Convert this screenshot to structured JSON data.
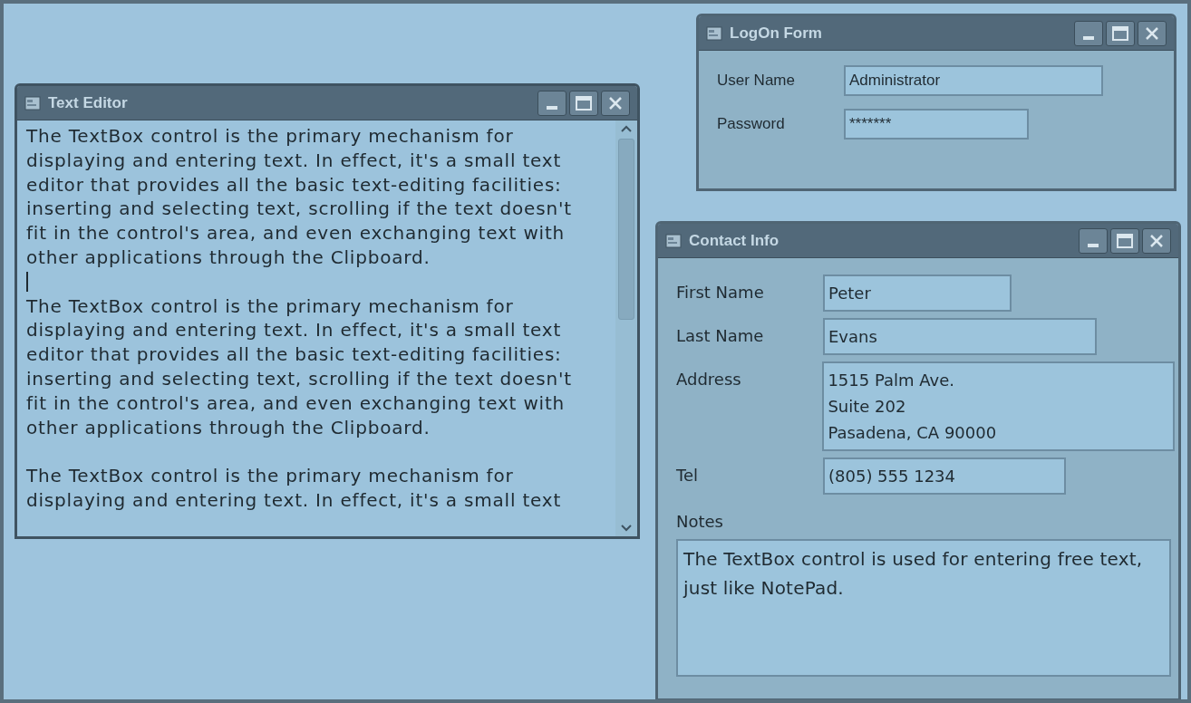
{
  "windows": [
    {
      "kind": "editor",
      "title": "Text Editor",
      "blocks": [
        {
          "kind": "text",
          "lines": [
            "The TextBox control is the primary mechanism for",
            "displaying and entering text. In effect, it's a small text",
            "editor that provides all the basic text-editing facilities:",
            "inserting and selecting text, scrolling if the text doesn't",
            "fit in the control's area, and even exchanging text with",
            "other applications through the Clipboard."
          ]
        },
        {
          "kind": "caret"
        },
        {
          "kind": "text",
          "lines": [
            "The TextBox control is the primary mechanism for",
            "displaying and entering text. In effect, it's a small text",
            "editor that provides all the basic text-editing facilities:",
            "inserting and selecting text, scrolling if the text doesn't",
            "fit in the control's area, and even exchanging text with",
            "other applications through the Clipboard."
          ]
        },
        {
          "kind": "blank"
        },
        {
          "kind": "text",
          "lines": [
            "The TextBox control is the primary mechanism for",
            "displaying and entering text. In effect, it's a small text"
          ]
        }
      ]
    },
    {
      "kind": "logon",
      "title": "LogOn Form",
      "fields": [
        {
          "label": "User Name",
          "value": "Administrator"
        },
        {
          "label": "Password",
          "value": "*******"
        }
      ]
    },
    {
      "kind": "contact",
      "title": "Contact Info",
      "fields": [
        {
          "label": "First Name",
          "lines": [
            "Peter"
          ]
        },
        {
          "label": "Last Name",
          "lines": [
            "Evans"
          ]
        },
        {
          "label": "Address",
          "lines": [
            "1515 Palm Ave.",
            "Suite 202",
            "Pasadena, CA 90000"
          ]
        },
        {
          "label": "Tel",
          "lines": [
            "(805) 555 1234"
          ]
        }
      ],
      "notes": {
        "label": "Notes",
        "value": "The TextBox control is used for entering free text, just like NotePad."
      }
    }
  ]
}
